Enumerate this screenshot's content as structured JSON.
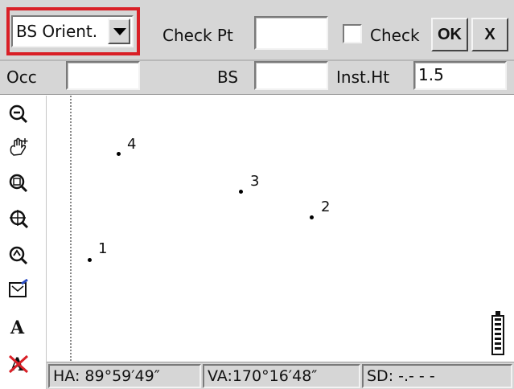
{
  "toolbar": {
    "mode_select": {
      "value": "BS Orient."
    },
    "check_pt_label": "Check Pt",
    "check_pt_value": "",
    "check_label": "Check",
    "ok_label": "OK",
    "close_label": "X",
    "occ_label": "Occ",
    "occ_value": "",
    "bs_label": "BS",
    "bs_value": "",
    "inst_ht_label": "Inst.Ht",
    "inst_ht_value": "1.5"
  },
  "tools": [
    {
      "icon": "zoom-out-icon"
    },
    {
      "icon": "pan-hand-icon"
    },
    {
      "icon": "zoom-window-icon"
    },
    {
      "icon": "zoom-extents-icon"
    },
    {
      "icon": "zoom-previous-icon"
    },
    {
      "icon": "settings-screen-icon"
    },
    {
      "icon": "text-icon"
    },
    {
      "icon": "text-off-icon"
    }
  ],
  "points": [
    {
      "label": "1"
    },
    {
      "label": "2"
    },
    {
      "label": "3"
    },
    {
      "label": "4"
    }
  ],
  "status": {
    "ha": "HA: 89°59′49″",
    "va": "VA:170°16′48″",
    "sd": "SD:    -.- - -"
  },
  "colors": {
    "highlight": "#d91f26",
    "panel": "#d6d6d6"
  }
}
